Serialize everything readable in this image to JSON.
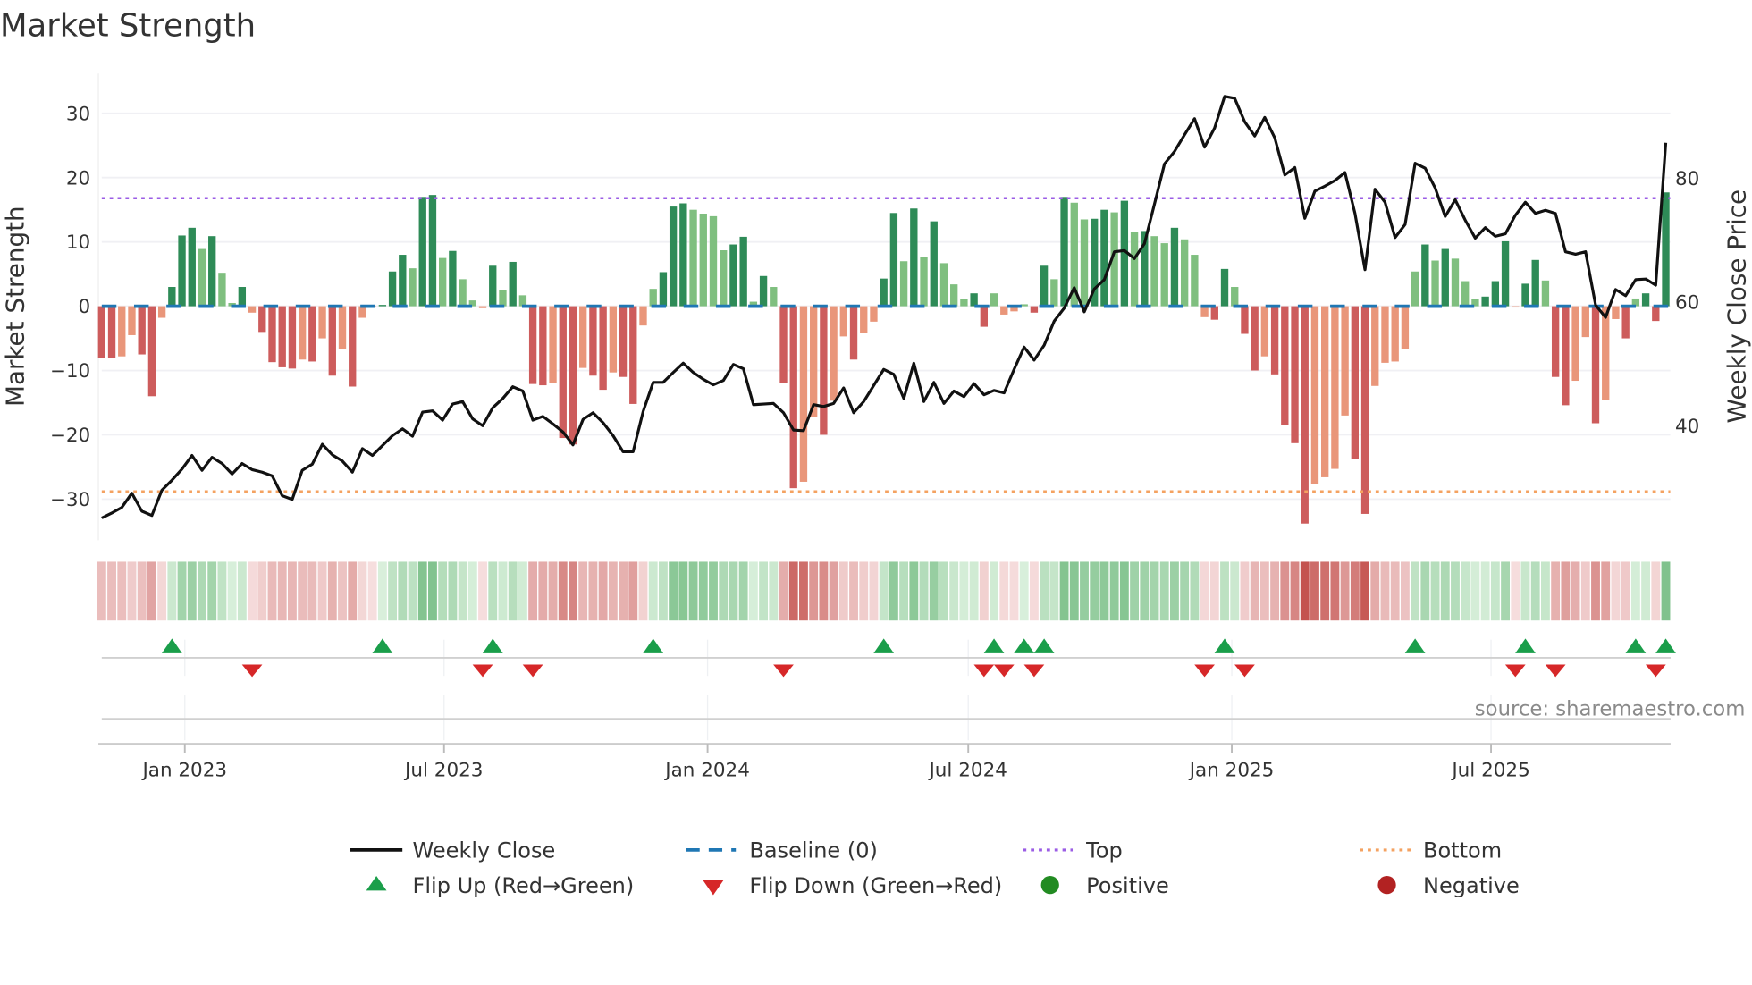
{
  "colors": {
    "rising_positive": "#2e8b57",
    "falling_positive": "#7fbf7f",
    "falling_negative": "#cd5c5c",
    "rising_negative": "#e9967a",
    "weekly_close": "#111111",
    "baseline": "#1f77b4",
    "top": "#9b5de5",
    "bottom": "#f4a261",
    "flip_up": "#1a9e4a",
    "flip_down": "#d62728",
    "positive": "#228b22",
    "negative": "#b22222"
  },
  "chart_data": {
    "type": "bar",
    "title": "Market Strength",
    "ylabel": "Market Strength",
    "y2label": "Weekly Close Price",
    "source": "source: sharemaestro.com",
    "x_start": "2022-11-04",
    "x_step_days": 7,
    "ylim": [
      -36.4,
      36.2
    ],
    "y2lim": [
      21.5,
      96.9
    ],
    "yticks": [
      -30,
      -20,
      -10,
      0,
      10,
      20,
      30
    ],
    "ytick_labels": [
      "−30",
      "−20",
      "−10",
      "0",
      "10",
      "20",
      "30"
    ],
    "y2ticks": [
      40,
      60,
      80
    ],
    "y2tick_labels": [
      "40",
      "60",
      "80"
    ],
    "xticks": [
      "2023-01-01",
      "2023-07-01",
      "2024-01-01",
      "2024-07-01",
      "2025-01-01",
      "2025-07-01"
    ],
    "xtick_labels": [
      "Jan 2023",
      "Jul 2023",
      "Jan 2024",
      "Jul 2024",
      "Jan 2025",
      "Jul 2025"
    ],
    "top_level": 16.8,
    "bottom_level": -28.8,
    "baseline": 0,
    "grid": true,
    "legend_placement": "bottom",
    "series": [
      {
        "name": "Market Strength",
        "type": "bar",
        "values": [
          -8,
          -8,
          -7.8,
          -4.5,
          -7.5,
          -14,
          -1.8,
          3,
          11,
          12.2,
          8.9,
          10.9,
          5.2,
          0.5,
          3,
          -1,
          -4,
          -8.7,
          -9.5,
          -9.7,
          -8.3,
          -8.6,
          -5,
          -10.8,
          -6.6,
          -12.5,
          -1.8,
          -0.1,
          0.2,
          5.4,
          8,
          5.9,
          17,
          17.3,
          7.5,
          8.6,
          4.2,
          0.9,
          -0.3,
          6.3,
          2.5,
          6.9,
          1.7,
          -12.1,
          -12.3,
          -12,
          -20.5,
          -21.5,
          -9.6,
          -10.8,
          -13,
          -10.3,
          -11,
          -15.2,
          -3,
          2.7,
          5.3,
          15.5,
          16,
          15,
          14.4,
          14,
          8.7,
          9.6,
          10.8,
          0.7,
          4.7,
          3,
          -12,
          -28.3,
          -27.3,
          -17.2,
          -20,
          -14.7,
          -4.7,
          -8.3,
          -4.2,
          -2.4,
          4.3,
          14.5,
          7,
          15.2,
          7.6,
          13.2,
          6.7,
          3.4,
          1.1,
          2,
          -3.2,
          2,
          -1.3,
          -0.8,
          0.3,
          -1,
          6.3,
          4.2,
          17,
          16.1,
          13.5,
          13.6,
          15,
          14.6,
          16.4,
          11.6,
          11.7,
          10.9,
          9.8,
          12.2,
          10.4,
          8,
          -1.7,
          -2.1,
          5.8,
          3,
          -4.3,
          -10,
          -7.8,
          -10.6,
          -18.5,
          -21.3,
          -33.8,
          -27.6,
          -26.6,
          -25.3,
          -17,
          -23.7,
          -32.3,
          -12.4,
          -8.8,
          -8.6,
          -6.7,
          5.4,
          9.6,
          7.1,
          8.9,
          7.4,
          3.9,
          1.1,
          1.5,
          3.9,
          10.1,
          -0.2,
          3.5,
          7.2,
          4,
          -11,
          -15.4,
          -11.6,
          -4.8,
          -18.2,
          -14.6,
          -2,
          -5,
          1.2,
          2,
          -2.3,
          17.7
        ]
      },
      {
        "name": "Weekly Close",
        "type": "line",
        "axis": "right",
        "values": [
          25.1,
          25.9,
          26.8,
          29.1,
          26.2,
          25.5,
          29.6,
          31.2,
          33.0,
          35.2,
          32.8,
          34.9,
          33.9,
          32.2,
          33.9,
          32.9,
          32.5,
          31.9,
          28.7,
          28.1,
          32.8,
          33.8,
          37.0,
          35.3,
          34.3,
          32.5,
          36.3,
          35.2,
          36.8,
          38.4,
          39.5,
          38.3,
          42.2,
          42.4,
          40.9,
          43.5,
          43.9,
          41.1,
          40.0,
          42.9,
          44.4,
          46.3,
          45.6,
          40.9,
          41.5,
          40.3,
          39.0,
          36.9,
          41.0,
          42.1,
          40.5,
          38.4,
          35.8,
          35.8,
          42.3,
          47.0,
          47.0,
          48.6,
          50.1,
          48.6,
          47.5,
          46.6,
          47.3,
          49.9,
          49.2,
          43.4,
          43.5,
          43.6,
          42.1,
          39.3,
          39.2,
          43.4,
          43.1,
          43.6,
          46.1,
          42.1,
          43.9,
          46.5,
          49.1,
          48.3,
          44.4,
          50.1,
          43.9,
          47.0,
          43.6,
          45.6,
          44.7,
          46.8,
          45.0,
          45.7,
          45.3,
          49.1,
          52.7,
          50.6,
          53.0,
          56.9,
          59.0,
          62.3,
          58.4,
          62.1,
          63.6,
          68.1,
          68.3,
          67.0,
          69.4,
          75.8,
          82.3,
          84.3,
          87.0,
          89.6,
          85.0,
          88.1,
          93.2,
          92.9,
          89.1,
          86.8,
          89.8,
          86.5,
          80.5,
          81.7,
          73.5,
          77.9,
          78.7,
          79.6,
          80.9,
          74.3,
          65.2,
          78.2,
          76.1,
          70.4,
          72.5,
          82.4,
          81.6,
          78.4,
          73.8,
          76.5,
          73.2,
          70.3,
          72.0,
          70.6,
          71.0,
          74.0,
          76.1,
          74.3,
          74.8,
          74.3,
          68.1,
          67.7,
          68.1,
          59.5,
          57.5,
          62.0,
          61.0,
          63.6,
          63.7,
          62.7,
          85.7
        ]
      }
    ],
    "legend": [
      {
        "label": "Weekly Close",
        "icon": "line"
      },
      {
        "label": "Baseline (0)",
        "icon": "dashed-line"
      },
      {
        "label": "Top",
        "icon": "dotted-line"
      },
      {
        "label": "Bottom",
        "icon": "dotted-line"
      },
      {
        "label": "Flip Up (Red→Green)",
        "icon": "triangle-up"
      },
      {
        "label": "Flip Down (Green→Red)",
        "icon": "triangle-down"
      },
      {
        "label": "Positive",
        "icon": "circle"
      },
      {
        "label": "Negative",
        "icon": "circle"
      }
    ]
  }
}
